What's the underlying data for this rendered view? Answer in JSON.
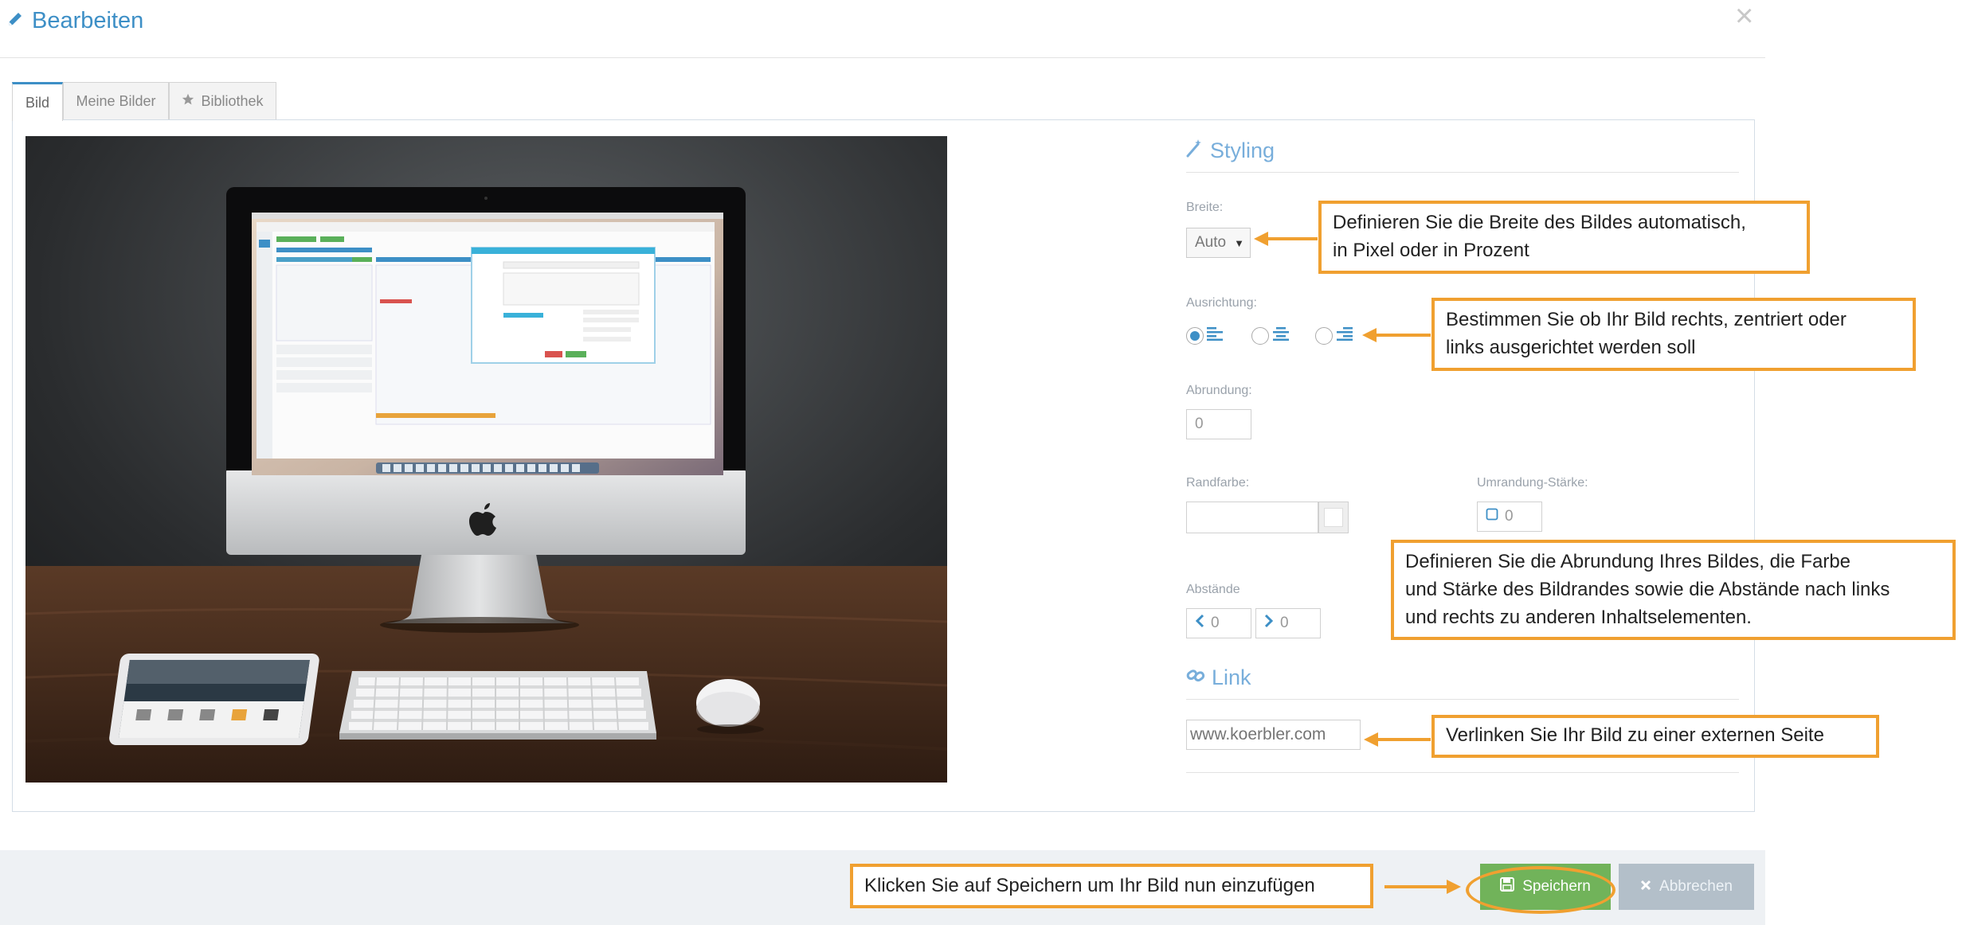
{
  "modal": {
    "title": "Bearbeiten",
    "close": "×"
  },
  "tabs": [
    {
      "label": "Bild"
    },
    {
      "label": "Meine Bilder"
    },
    {
      "label": "Bibliothek"
    }
  ],
  "styling": {
    "heading": "Styling",
    "width_label": "Breite:",
    "width_value": "Auto",
    "alignment_label": "Ausrichtung:",
    "rounding_label": "Abrundung:",
    "rounding_value": "0",
    "border_color_label": "Randfarbe:",
    "border_strength_label": "Umrandung-Stärke:",
    "border_strength_value": "0",
    "spacing_label": "Abstände",
    "spacing_left_value": "0",
    "spacing_right_value": "0"
  },
  "link": {
    "heading": "Link",
    "placeholder": "www.koerbler.com"
  },
  "callouts": {
    "width_line1": "Definieren Sie die Breite des Bildes automatisch,",
    "width_line2": "in Pixel oder in Prozent",
    "align_line1": "Bestimmen Sie ob Ihr Bild rechts, zentriert oder",
    "align_line2": "links ausgerichtet werden soll",
    "round_line1": "Definieren Sie die Abrundung Ihres Bildes, die Farbe",
    "round_line2": "und Stärke des Bildrandes sowie die Abstände nach links",
    "round_line3": "und rechts zu anderen Inhaltselementen.",
    "link_text": "Verlinken Sie Ihr Bild zu einer externen Seite",
    "save_text": "Klicken Sie auf Speichern um Ihr Bild nun einzufügen"
  },
  "footer": {
    "save_label": "Speichern",
    "cancel_label": "Abbrechen"
  },
  "colors": {
    "accent": "#3d8fc6",
    "callout_border": "#f0a030",
    "save_button": "#71b35a",
    "cancel_button": "#b3bfc9"
  },
  "icons": {
    "title": "pencil-icon",
    "close": "close-icon",
    "library_tab": "star-icon",
    "styling": "magic-wand-icon",
    "link": "link-icon",
    "save": "floppy-disk-icon",
    "cancel": "x-icon"
  }
}
